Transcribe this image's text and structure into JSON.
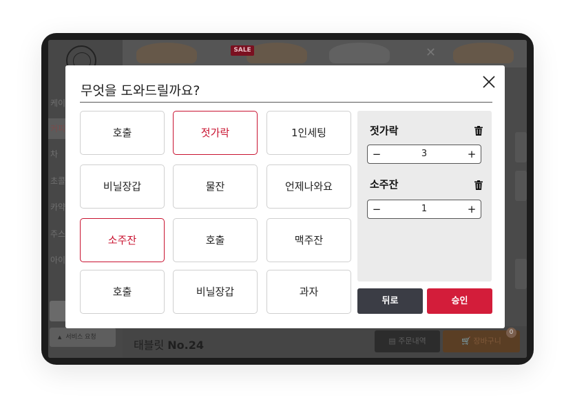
{
  "modal": {
    "title": "무엇을 도와드릴까요?",
    "options": [
      {
        "label": "호출",
        "selected": false
      },
      {
        "label": "젓가락",
        "selected": true
      },
      {
        "label": "1인세팅",
        "selected": false
      },
      {
        "label": "비닐장갑",
        "selected": false
      },
      {
        "label": "물잔",
        "selected": false
      },
      {
        "label": "언제나와요",
        "selected": false
      },
      {
        "label": "소주잔",
        "selected": true
      },
      {
        "label": "호출",
        "selected": false
      },
      {
        "label": "맥주잔",
        "selected": false
      },
      {
        "label": "호출",
        "selected": false
      },
      {
        "label": "비닐장갑",
        "selected": false
      },
      {
        "label": "과자",
        "selected": false
      }
    ],
    "selected_items": [
      {
        "name": "젓가락",
        "quantity": "3"
      },
      {
        "name": "소주잔",
        "quantity": "1"
      }
    ],
    "stepper": {
      "minus": "−",
      "plus": "+"
    },
    "back_label": "뒤로",
    "approve_label": "승인"
  },
  "background": {
    "sale_badge": "SALE",
    "categories": [
      "케이",
      "커피",
      "차",
      "초콜",
      "카약",
      "주스",
      "아이"
    ],
    "service_label": "서비스 요청",
    "table_prefix": "태블릿 ",
    "table_number": "No.24",
    "order_history_label": "주문내역",
    "cart_label": "장바구니",
    "cart_count": "0"
  },
  "colors": {
    "accent": "#d31d3a",
    "selected_border": "#c8102e",
    "back_button": "#3b3d45",
    "panel_bg": "#ebebeb"
  }
}
